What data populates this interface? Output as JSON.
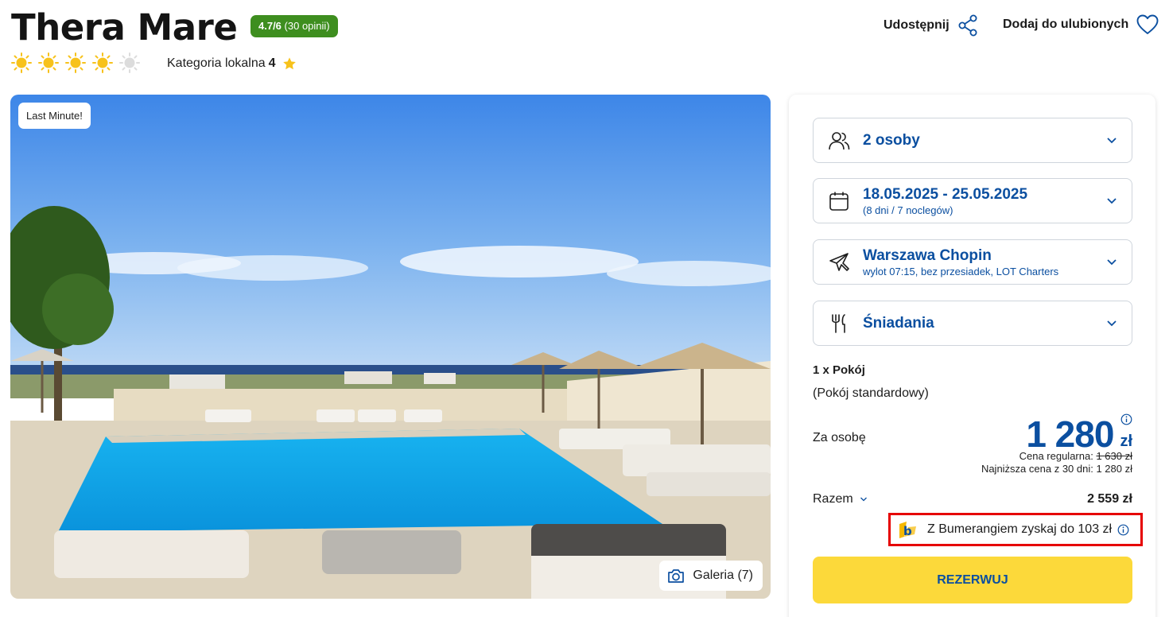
{
  "hotel": {
    "name": "Thera Mare",
    "rating_score": "4.7/6",
    "rating_reviews": "(30 opinii)",
    "stars_filled": 4,
    "stars_total": 5,
    "local_category_label": "Kategoria lokalna",
    "local_category_value": "4"
  },
  "actions": {
    "share_label": "Udostępnij",
    "favorite_label": "Dodaj do ulubionych"
  },
  "photo": {
    "badge": "Last Minute!",
    "gallery_label": "Galeria (7)"
  },
  "booking": {
    "travelers": "2 osoby",
    "dates": "18.05.2025 - 25.05.2025",
    "dates_sub": "(8 dni / 7 noclegów)",
    "departure": "Warszawa Chopin",
    "departure_sub": "wylot 07:15, bez przesiadek, LOT Charters",
    "board": "Śniadania",
    "room_count": "1 x Pokój",
    "room_type": "(Pokój standardowy)",
    "per_person_label": "Za osobę",
    "price": "1 280",
    "currency": "zł",
    "regular_label": "Cena regularna:",
    "regular_price": "1 630 zł",
    "lowest_label": "Najniższa cena z 30 dni: 1 280 zł",
    "total_label": "Razem",
    "total_value": "2 559 zł",
    "bumerang_text": "Z Bumerangiem zyskaj do 103 zł",
    "reserve_label": "REZERWUJ"
  },
  "colors": {
    "accent_blue": "#0b4fa0",
    "badge_green": "#3e8e1f",
    "button_yellow": "#fcd93a",
    "highlight_red": "#e60000",
    "sun_yellow": "#f7c21b"
  }
}
